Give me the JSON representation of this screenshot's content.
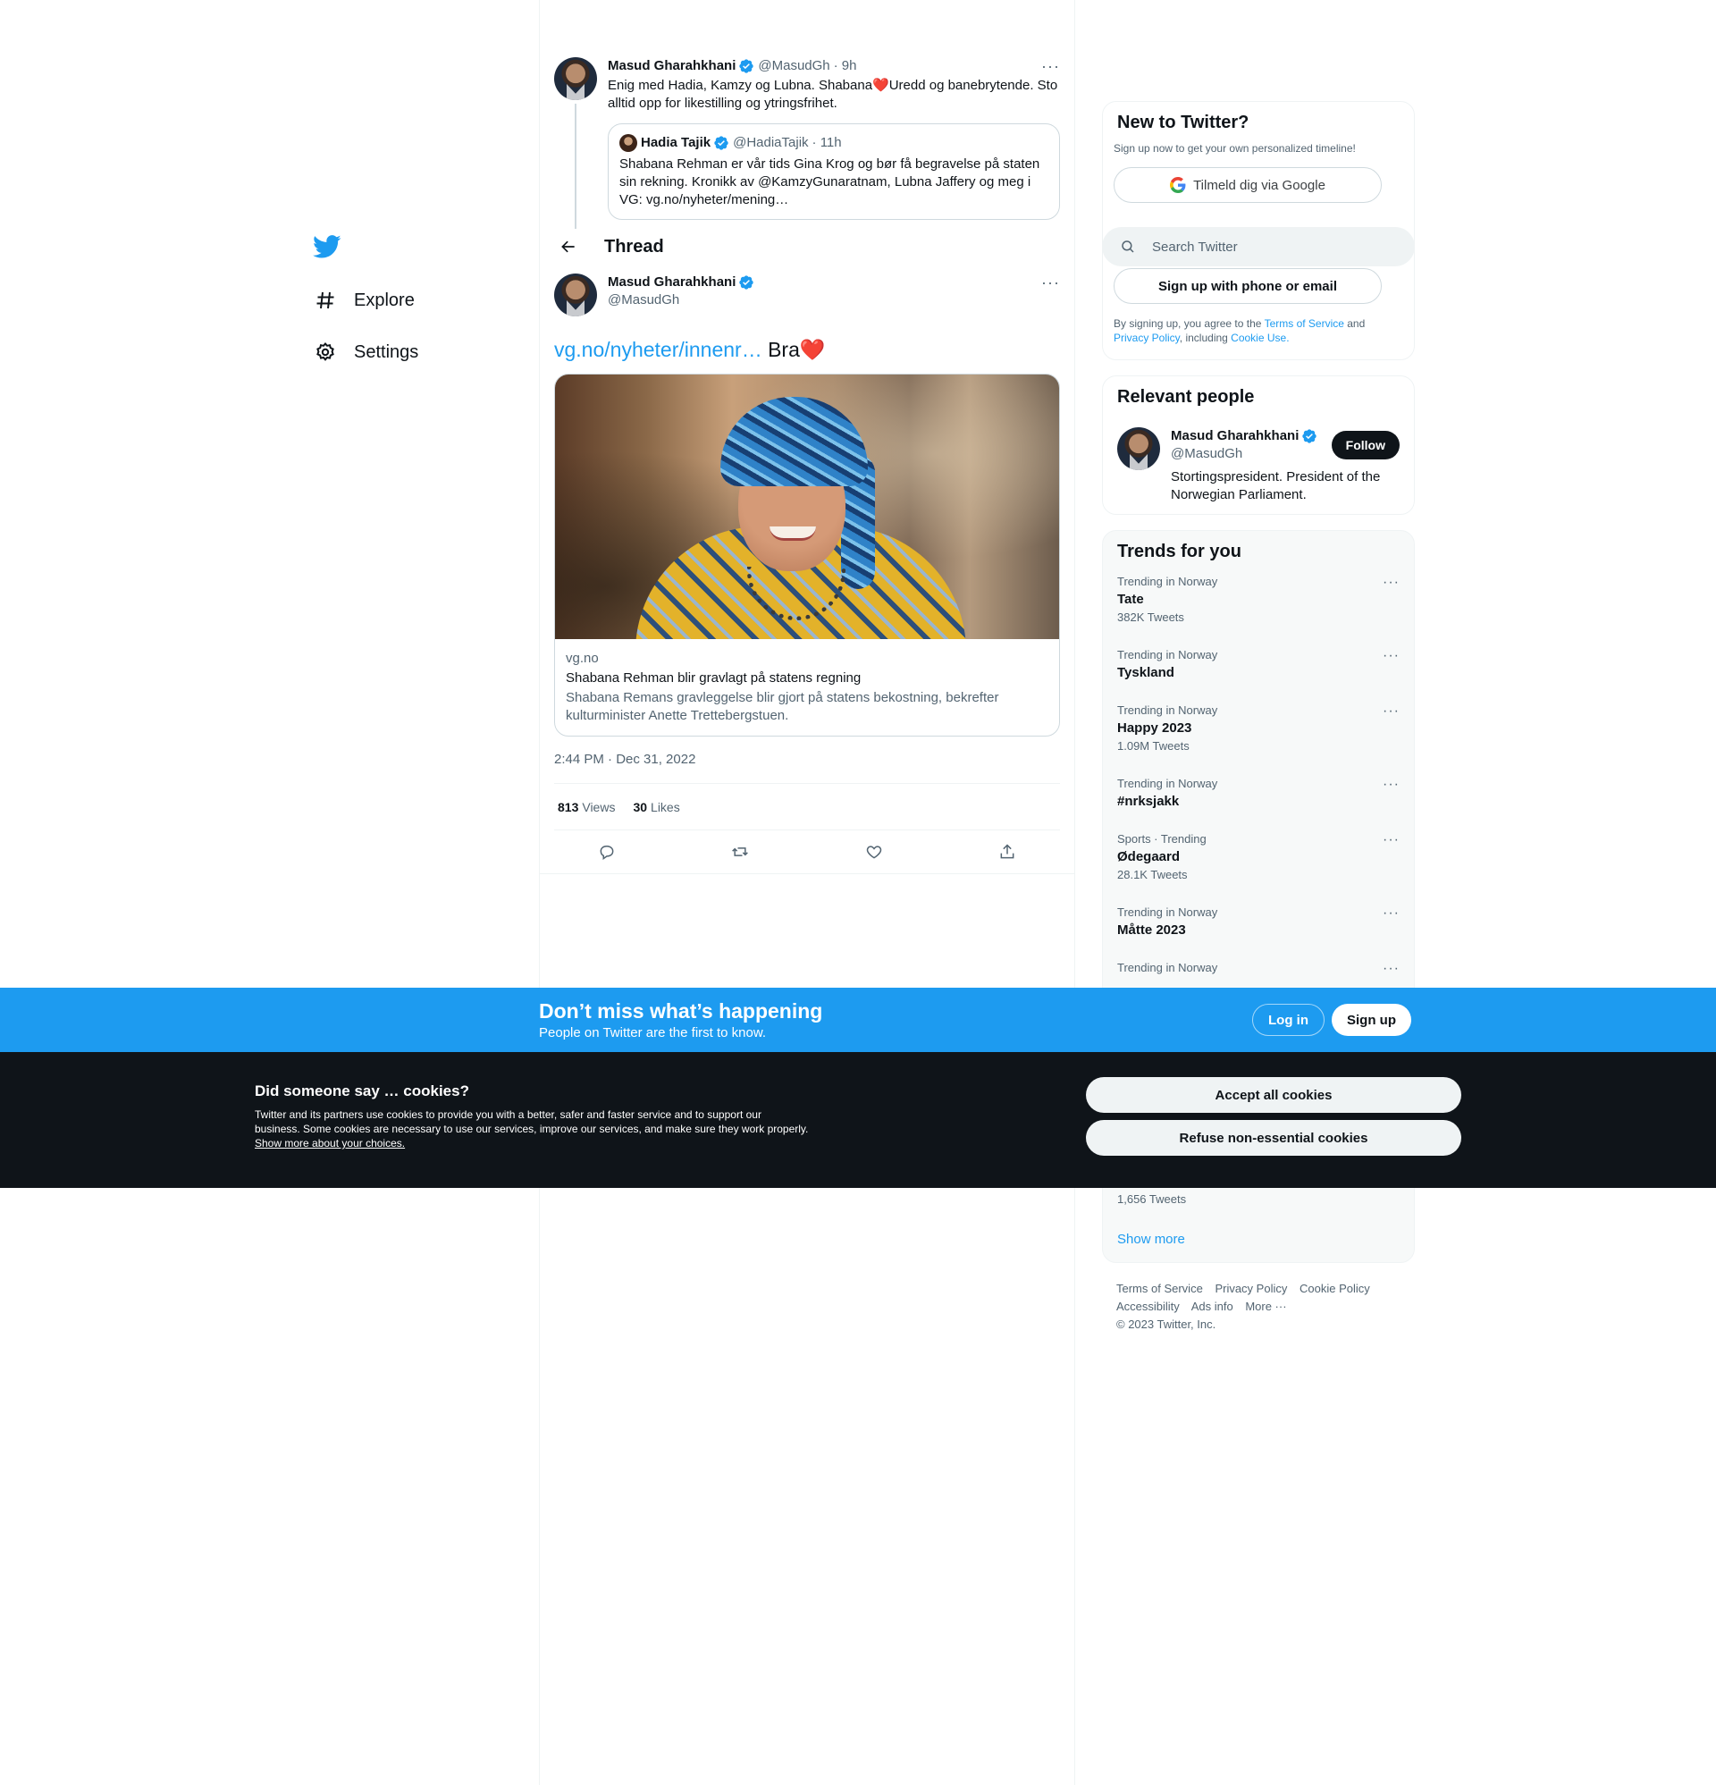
{
  "nav": {
    "logo": "twitter-bird-icon",
    "items": [
      {
        "label": "Explore",
        "icon": "hashtag-icon"
      },
      {
        "label": "Settings",
        "icon": "gear-icon"
      }
    ]
  },
  "prev_tweet": {
    "name": "Masud Gharahkhani",
    "handle": "@MasudGh",
    "time": "· 9h",
    "text_a": "Enig med Hadia, Kamzy og Lubna. Shabana",
    "heart": "❤️",
    "text_b": "Uredd og banebrytende. Sto alltid opp for likestilling og ytringsfrihet.",
    "quote": {
      "name": "Hadia Tajik",
      "handle": "@HadiaTajik",
      "time": "· 11h",
      "text": "Shabana Rehman er vår tids Gina Krog og bør få begravelse på staten sin rekning. Kronikk av  @KamzyGunaratnam, Lubna Jaffery og meg i VG: vg.no/nyheter/mening…"
    }
  },
  "thread": {
    "title": "Thread"
  },
  "main_tweet": {
    "name": "Masud Gharahkhani",
    "handle": "@MasudGh",
    "link": "vg.no/nyheter/innenr…",
    "text": " Bra",
    "heart": "❤️",
    "card": {
      "domain": "vg.no",
      "title": "Shabana Rehman blir gravlagt på statens regning",
      "description": "Shabana Remans gravleggelse blir gjort på statens bekostning, bekrefter kulturminister Anette Trettebergstuen."
    },
    "timestamp": "2:44 PM · Dec 31, 2022",
    "views_count": "813",
    "views_label": "Views",
    "likes_count": "30",
    "likes_label": "Likes"
  },
  "signup": {
    "title": "New to Twitter?",
    "subtitle": "Sign up now to get your own personalized timeline!",
    "google_label": "Tilmeld dig via Google",
    "phone_label": "Sign up with phone or email",
    "legal_a": "By signing up, you agree to the ",
    "tos": "Terms of Service",
    "legal_b": " and ",
    "privacy": "Privacy Policy",
    "legal_c": ", including ",
    "cookie_use": "Cookie Use."
  },
  "search": {
    "placeholder": "Search Twitter"
  },
  "relevant": {
    "title": "Relevant people",
    "name": "Masud Gharahkhani",
    "handle": "@MasudGh",
    "bio": "Stortingspresident. President of the Norwegian Parliament.",
    "follow_label": "Follow"
  },
  "trends": {
    "title": "Trends for you",
    "items": [
      {
        "meta": "Trending in Norway",
        "topic": "Tate",
        "count": "382K Tweets"
      },
      {
        "meta": "Trending in Norway",
        "topic": "Tyskland",
        "count": ""
      },
      {
        "meta": "Trending in Norway",
        "topic": "Happy 2023",
        "count": "1.09M Tweets"
      },
      {
        "meta": "Trending in Norway",
        "topic": "#nrksjakk",
        "count": ""
      },
      {
        "meta": "Sports · Trending",
        "topic": "Ødegaard",
        "count": "28.1K Tweets"
      },
      {
        "meta": "Trending in Norway",
        "topic": "Måtte 2023",
        "count": ""
      },
      {
        "meta": "Trending in Norway",
        "topic": "",
        "count": ""
      }
    ],
    "last_count": "1,656 Tweets",
    "show_more": "Show more"
  },
  "footer": {
    "links": [
      "Terms of Service",
      "Privacy Policy",
      "Cookie Policy",
      "Accessibility",
      "Ads info",
      "More ···"
    ],
    "copyright": "© 2023 Twitter, Inc."
  },
  "banner": {
    "title": "Don’t miss what’s happening",
    "subtitle": "People on Twitter are the first to know.",
    "login": "Log in",
    "signup": "Sign up"
  },
  "cookies": {
    "title": "Did someone say … cookies?",
    "text": "Twitter and its partners use cookies to provide you with a better, safer and faster service and to support our business. Some cookies are necessary to use our services, improve our services, and make sure they work properly. ",
    "link": "Show more about your choices.",
    "accept": "Accept all cookies",
    "refuse": "Refuse non-essential cookies"
  },
  "colors": {
    "accent": "#1d9bf0",
    "text": "#0f1419",
    "secondary": "#536471",
    "cookie_bg": "#0f1419"
  }
}
